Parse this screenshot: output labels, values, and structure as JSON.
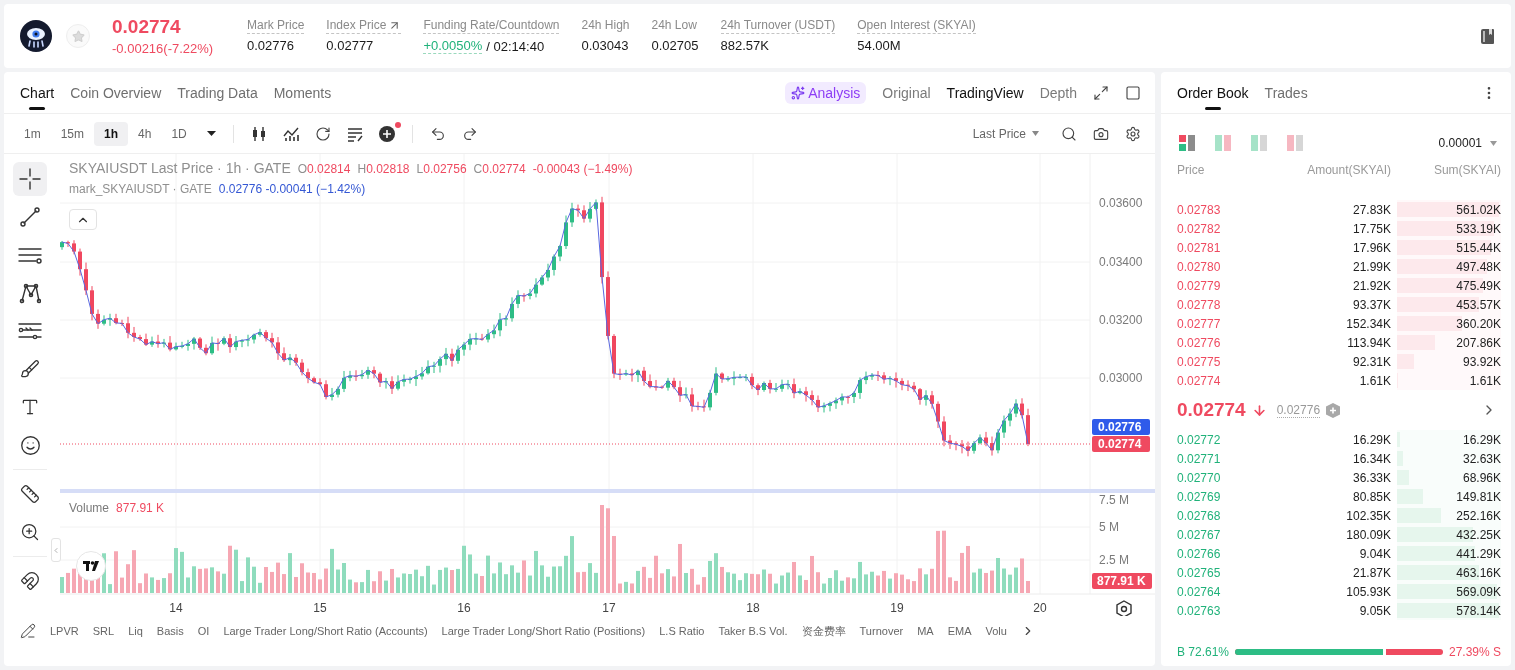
{
  "header": {
    "price": "0.02774",
    "falling": true,
    "change": "-0.00216(-7.22%)",
    "stats": [
      {
        "kind": "plain",
        "label": "Mark Price",
        "value": "0.02776",
        "underlined": true
      },
      {
        "kind": "link",
        "label": "Index Price",
        "value": "0.02777",
        "underlined": true
      },
      {
        "kind": "funding",
        "label": "Funding Rate/Countdown",
        "value": "+0.0050%",
        "countdown": "/ 02:14:40",
        "underlined": true
      },
      {
        "kind": "plain",
        "label": "24h High",
        "value": "0.03043",
        "underlined": false
      },
      {
        "kind": "plain",
        "label": "24h Low",
        "value": "0.02705",
        "underlined": false
      },
      {
        "kind": "plain",
        "label": "24h Turnover (USDT)",
        "value": "882.57K",
        "underlined": true
      },
      {
        "kind": "plain",
        "label": "Open Interest (SKYAI)",
        "value": "54.00M",
        "underlined": true
      }
    ]
  },
  "chart_panel": {
    "tabs": [
      {
        "label": "Chart",
        "selected": true
      },
      {
        "label": "Coin Overview",
        "selected": false
      },
      {
        "label": "Trading Data",
        "selected": false
      },
      {
        "label": "Moments",
        "selected": false
      }
    ],
    "views": [
      {
        "kind": "ai",
        "label": "Analysis",
        "selected": false
      },
      {
        "kind": "view",
        "label": "Original",
        "selected": false
      },
      {
        "kind": "view",
        "label": "TradingView",
        "selected": true
      },
      {
        "kind": "view",
        "label": "Depth",
        "selected": false
      }
    ],
    "intervals": [
      {
        "label": "1m",
        "selected": false
      },
      {
        "label": "15m",
        "selected": false
      },
      {
        "label": "1h",
        "selected": true
      },
      {
        "label": "4h",
        "selected": false
      },
      {
        "label": "1D",
        "selected": false
      }
    ],
    "price_source": "Last Price",
    "tool_groups": [
      {
        "tools": [
          {
            "kind": "crosshair",
            "selected": true
          },
          {
            "kind": "trend-line",
            "selected": false
          },
          {
            "kind": "horizontal-lines",
            "selected": false
          },
          {
            "kind": "pattern",
            "selected": false
          },
          {
            "kind": "levels",
            "selected": false
          },
          {
            "kind": "brush",
            "selected": false
          },
          {
            "kind": "text",
            "selected": false
          },
          {
            "kind": "emoji",
            "selected": false
          }
        ]
      },
      {
        "tools": [
          {
            "kind": "ruler",
            "selected": false
          },
          {
            "kind": "zoom",
            "selected": false
          }
        ]
      },
      {
        "tools": [
          {
            "kind": "magnet",
            "selected": false
          }
        ]
      }
    ],
    "legend": {
      "title": "SKYAIUSDT Last Price · 1h · GATE",
      "ohlc": [
        {
          "key": "O",
          "value": "0.02814"
        },
        {
          "key": "H",
          "value": "0.02818"
        },
        {
          "key": "L",
          "value": "0.02756"
        },
        {
          "key": "C",
          "value": "0.02774"
        }
      ],
      "change": "-0.00043 (−1.49%)"
    },
    "mark_legend": {
      "title": "mark_SKYAIUSDT · GATE",
      "value": "0.02776 -0.00041 (−1.42%)"
    },
    "price_axis": [
      "0.03600",
      "0.03400",
      "0.03200",
      "0.03000"
    ],
    "mark_price_tag": "0.02776",
    "last_price_tag": "0.02774",
    "volume": {
      "label": "Volume",
      "value": "877.91 K",
      "axis": [
        "7.5 M",
        "5 M",
        "2.5 M"
      ],
      "tag": "877.91 K"
    },
    "time_axis": [
      "14",
      "15",
      "16",
      "17",
      "18",
      "19",
      "20"
    ],
    "indicators": [
      "LPVR",
      "SRL",
      "Liq",
      "Basis",
      "OI",
      "Large Trader Long/Short Ratio (Accounts)",
      "Large Trader Long/Short Ratio (Positions)",
      "L.S Ratio",
      "Taker B.S Vol.",
      "资金费率",
      "Turnover",
      "MA",
      "EMA",
      "Volu"
    ]
  },
  "order_book": {
    "tabs": [
      {
        "label": "Order Book",
        "selected": true
      },
      {
        "label": "Trades",
        "selected": false
      }
    ],
    "layouts": [
      {
        "kind": "stacked",
        "selected": true
      },
      {
        "kind": "both",
        "selected": false
      },
      {
        "kind": "bids",
        "selected": false
      },
      {
        "kind": "asks",
        "selected": false
      }
    ],
    "precision": "0.00001",
    "columns": [
      "Price",
      "Amount(SKYAI)",
      "Sum(SKYAI)"
    ],
    "asks": [
      {
        "price": "0.02783",
        "amount": "27.83K",
        "sum": "561.02K",
        "level": 1.0
      },
      {
        "price": "0.02782",
        "amount": "17.75K",
        "sum": "533.19K",
        "level": 0.95
      },
      {
        "price": "0.02781",
        "amount": "17.96K",
        "sum": "515.44K",
        "level": 0.919
      },
      {
        "price": "0.02780",
        "amount": "21.99K",
        "sum": "497.48K",
        "level": 0.887
      },
      {
        "price": "0.02779",
        "amount": "21.92K",
        "sum": "475.49K",
        "level": 0.848
      },
      {
        "price": "0.02778",
        "amount": "93.37K",
        "sum": "453.57K",
        "level": 0.808
      },
      {
        "price": "0.02777",
        "amount": "152.34K",
        "sum": "360.20K",
        "level": 0.642
      },
      {
        "price": "0.02776",
        "amount": "113.94K",
        "sum": "207.86K",
        "level": 0.37
      },
      {
        "price": "0.02775",
        "amount": "92.31K",
        "sum": "93.92K",
        "level": 0.167
      },
      {
        "price": "0.02774",
        "amount": "1.61K",
        "sum": "1.61K",
        "level": 0.003
      }
    ],
    "last_price": "0.02774",
    "falling": true,
    "mark_price": "0.02776",
    "bids": [
      {
        "price": "0.02772",
        "amount": "16.29K",
        "sum": "16.29K",
        "level": 0.028
      },
      {
        "price": "0.02771",
        "amount": "16.34K",
        "sum": "32.63K",
        "level": 0.056
      },
      {
        "price": "0.02770",
        "amount": "36.33K",
        "sum": "68.96K",
        "level": 0.119
      },
      {
        "price": "0.02769",
        "amount": "80.85K",
        "sum": "149.81K",
        "level": 0.259
      },
      {
        "price": "0.02768",
        "amount": "102.35K",
        "sum": "252.16K",
        "level": 0.436
      },
      {
        "price": "0.02767",
        "amount": "180.09K",
        "sum": "432.25K",
        "level": 0.748
      },
      {
        "price": "0.02766",
        "amount": "9.04K",
        "sum": "441.29K",
        "level": 0.763
      },
      {
        "price": "0.02765",
        "amount": "21.87K",
        "sum": "463.16K",
        "level": 0.801
      },
      {
        "price": "0.02764",
        "amount": "105.93K",
        "sum": "569.09K",
        "level": 0.984
      },
      {
        "price": "0.02763",
        "amount": "9.05K",
        "sum": "578.14K",
        "level": 1.0
      }
    ],
    "ratio": {
      "buy": "B 72.61%",
      "sell": "27.39% S",
      "level": 0.7261
    }
  }
}
